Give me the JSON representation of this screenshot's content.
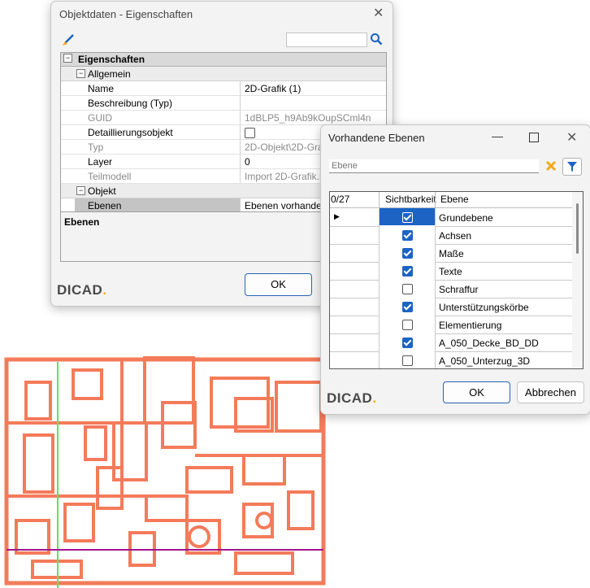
{
  "props_dialog": {
    "title": "Objektdaten - Eigenschaften",
    "search_value": "",
    "section_title": "Eigenschaften",
    "group_general": "Allgemein",
    "rows": [
      {
        "label": "Name",
        "value": "2D-Grafik (1)",
        "grayed": false
      },
      {
        "label": "Beschreibung (Typ)",
        "value": "",
        "grayed": false
      },
      {
        "label": "GUID",
        "value": "1dBLP5_h9Ab9kOupSCml4n",
        "grayed": true
      },
      {
        "label": "Detaillierungsobjekt",
        "value": "",
        "checkbox": true,
        "grayed": false
      },
      {
        "label": "Typ",
        "value": "2D-Objekt\\2D-Grafik",
        "grayed": true
      },
      {
        "label": "Layer",
        "value": "0",
        "grayed": false
      },
      {
        "label": "Teilmodell",
        "value": "Import 2D-Grafik.sbm",
        "grayed": true
      }
    ],
    "group_object": "Objekt",
    "layers_row": {
      "label": "Ebenen",
      "value": "Ebenen vorhanden"
    },
    "description_title": "Ebenen",
    "ok_label": "OK",
    "logo_text": "DICAD",
    "logo_dot": "."
  },
  "layers_dialog": {
    "title": "Vorhandene Ebenen",
    "filter_placeholder": "Ebene",
    "count": "0/27",
    "col_visibility": "Sichtbarkeit",
    "col_layer": "Ebene",
    "rows": [
      {
        "name": "Grundebene",
        "visible": true,
        "current": true
      },
      {
        "name": "Achsen",
        "visible": true,
        "current": false
      },
      {
        "name": "Maße",
        "visible": true,
        "current": false
      },
      {
        "name": "Texte",
        "visible": true,
        "current": false
      },
      {
        "name": "Schraffur",
        "visible": false,
        "current": false
      },
      {
        "name": "Unterstützungskörbe",
        "visible": true,
        "current": false
      },
      {
        "name": "Elementierung",
        "visible": false,
        "current": false
      },
      {
        "name": "A_050_Decke_BD_DD",
        "visible": true,
        "current": false
      },
      {
        "name": "A_050_Unterzug_3D",
        "visible": false,
        "current": false
      }
    ],
    "ok_label": "OK",
    "cancel_label": "Abbrechen",
    "logo_text": "DICAD",
    "logo_dot": "."
  },
  "colors": {
    "cad_lines": "#f47b5a",
    "axis_green": "#5ee35e",
    "axis_magenta": "#a2148c",
    "accent_blue": "#1c63c4",
    "logo_orange": "#f2a81d"
  }
}
